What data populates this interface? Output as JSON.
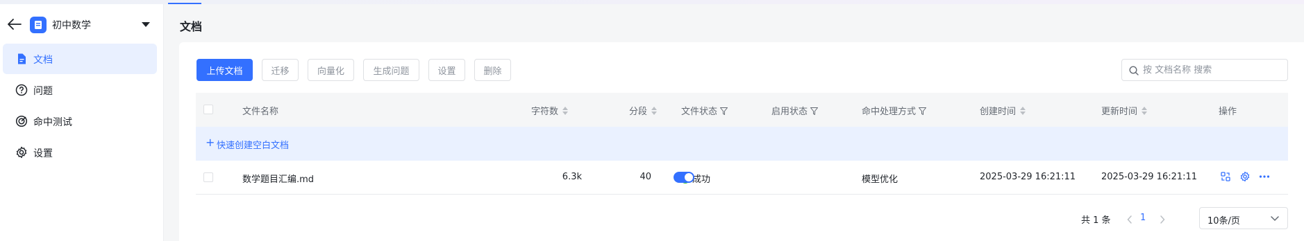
{
  "sidebar": {
    "kb_name": "初中数学",
    "items": [
      {
        "label": "文档",
        "icon": "document-icon",
        "active": true
      },
      {
        "label": "问题",
        "icon": "question-icon",
        "active": false
      },
      {
        "label": "命中测试",
        "icon": "target-icon",
        "active": false
      },
      {
        "label": "设置",
        "icon": "gear-icon",
        "active": false
      }
    ]
  },
  "header": {
    "title": "文档"
  },
  "toolbar": {
    "upload_label": "上传文档",
    "migrate_label": "迁移",
    "vectorize_label": "向量化",
    "generate_label": "生成问题",
    "settings_label": "设置",
    "delete_label": "删除"
  },
  "search": {
    "placeholder": "按 文档名称 搜索",
    "value": ""
  },
  "table": {
    "columns": [
      "文件名称",
      "字符数",
      "分段",
      "文件状态",
      "启用状态",
      "命中处理方式",
      "创建时间",
      "更新时间",
      "操作"
    ],
    "quick_create": "快速创建空白文档",
    "rows": [
      {
        "name": "数学题目汇编.md",
        "chars": "6.3k",
        "segments": "40",
        "status": "成功",
        "enabled": true,
        "hit_mode": "模型优化",
        "created": "2025-03-29 16:21:11",
        "updated": "2025-03-29 16:21:11"
      }
    ]
  },
  "pagination": {
    "total": "共 1 条",
    "current": "1",
    "page_size": "10条/页"
  },
  "colors": {
    "accent": "#3370ff",
    "success": "#34c724",
    "active_bg": "#e9f0ff"
  }
}
